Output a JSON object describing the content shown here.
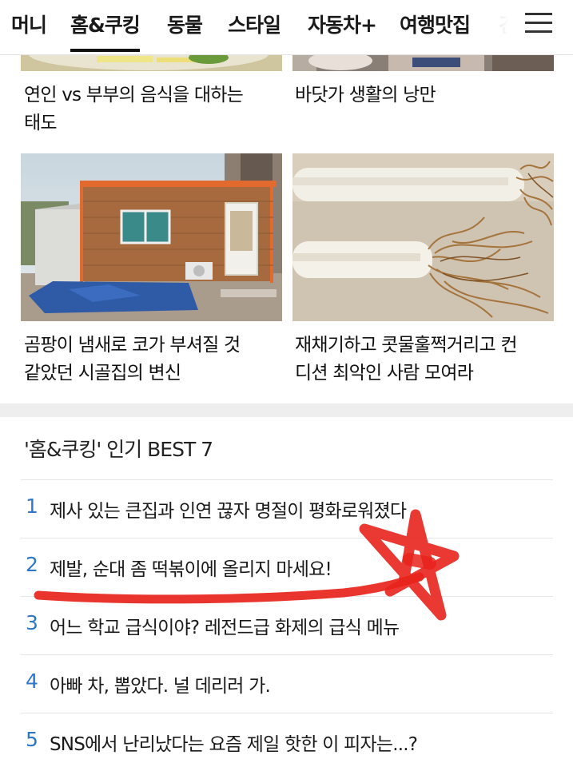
{
  "nav": {
    "tabs": [
      "머니",
      "홈&쿠킹",
      "동물",
      "스타일",
      "자동차+",
      "여행맛집",
      "건"
    ],
    "active": "홈&쿠킹"
  },
  "cards": [
    {
      "caption": "연인 vs 부부의 음식을 대하는\n태도"
    },
    {
      "caption": "바닷가 생활의 낭만"
    },
    {
      "caption": "곰팡이 냄새로 코가 부셔질 것\n같았던 시골집의 변신"
    },
    {
      "caption": "재채기하고 콧물훌쩍거리고 컨\n디션 최악인 사람 모여라"
    }
  ],
  "best": {
    "title": "'홈&쿠킹' 인기 BEST 7",
    "items": [
      {
        "rank": "1",
        "text": "제사 있는 큰집과 인연 끊자 명절이 평화로워졌다"
      },
      {
        "rank": "2",
        "text": "제발, 순대 좀 떡볶이에 올리지 마세요!"
      },
      {
        "rank": "3",
        "text": "어느 학교 급식이야? 레전드급 화제의 급식 메뉴"
      },
      {
        "rank": "4",
        "text": "아빠 차, 뽑았다. 널 데리러 가."
      },
      {
        "rank": "5",
        "text": "SNS에서 난리났다는 요즘 제일 핫한 이 피자는...?"
      }
    ]
  },
  "colors": {
    "rank": "#2f77c8",
    "annotation": "#e8231c"
  },
  "icons": {
    "menu": "hamburger-menu-icon"
  }
}
